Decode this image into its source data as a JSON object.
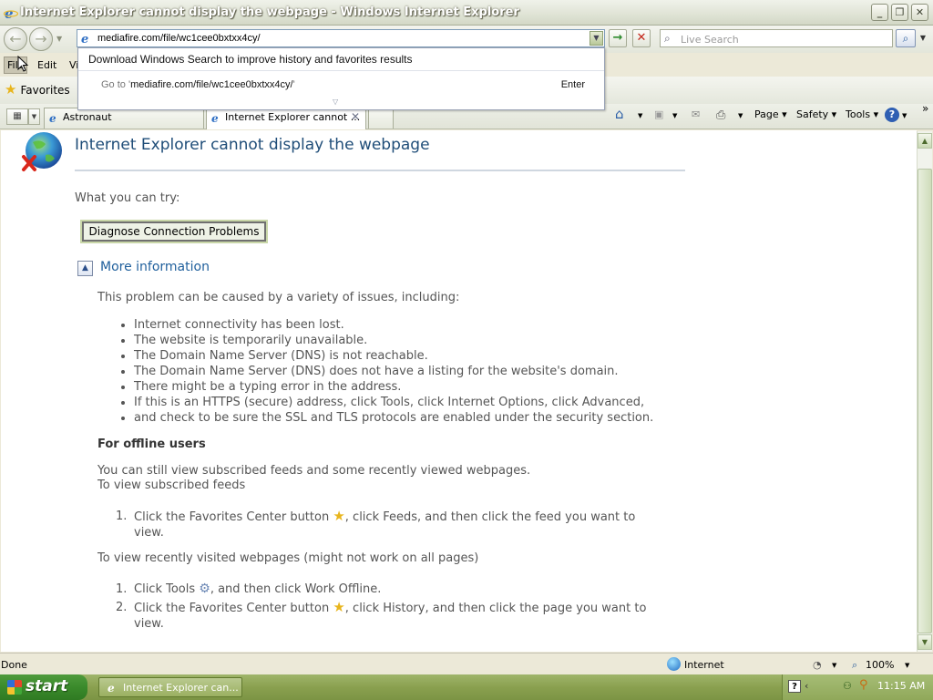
{
  "window": {
    "title": "Internet Explorer cannot display the webpage - Windows Internet Explorer",
    "controls": {
      "minimize": "_",
      "maximize": "❐",
      "close": "✕"
    }
  },
  "nav": {
    "address": "mediafire.com/file/wc1cee0bxtxx4cy/",
    "search_placeholder": "Live Search"
  },
  "autocomplete": {
    "promo": "Download Windows Search to improve history and favorites results",
    "goto_prefix": "Go to '",
    "goto_url": "mediafire.com/file/wc1cee0bxtxx4cy/",
    "goto_suffix": "'",
    "enter_label": "Enter"
  },
  "menu": {
    "file": "File",
    "edit": "Edit",
    "view": "Vi"
  },
  "favorites": {
    "label": "Favorites"
  },
  "tabs": [
    {
      "label": "Astronaut"
    },
    {
      "label": "Internet Explorer cannot ..."
    }
  ],
  "commandbar": {
    "page": "Page",
    "safety": "Safety",
    "tools": "Tools"
  },
  "page": {
    "title": "Internet Explorer cannot display the webpage",
    "what_you_can_try": "What you can try:",
    "diagnose_button": "Diagnose Connection Problems",
    "more_information": "More information",
    "problem_intro": "This problem can be caused by a variety of issues, including:",
    "causes": [
      "Internet connectivity has been lost.",
      "The website is temporarily unavailable.",
      "The Domain Name Server (DNS) is not reachable.",
      "The Domain Name Server (DNS) does not have a listing for the website's domain.",
      "There might be a typing error in the address.",
      "If this is an HTTPS (secure) address, click Tools, click Internet Options, click Advanced,",
      "and check to be sure the SSL and TLS protocols are enabled under the security section."
    ],
    "offline_heading": "For offline users",
    "offline_line1": "You can still view subscribed feeds and some recently viewed webpages.",
    "offline_line2": "To view subscribed feeds",
    "feeds_steps": [
      {
        "n": "1.",
        "a": "Click the Favorites Center button ",
        "b": ", click Feeds, and then click the feed you want to",
        "c": "view."
      }
    ],
    "recent_heading": "To view recently visited webpages (might not work on all pages)",
    "recent_steps": [
      {
        "n": "1.",
        "a": "Click Tools ",
        "b": ", and then click Work Offline."
      },
      {
        "n": "2.",
        "a": "Click the Favorites Center button ",
        "b": ", click History, and then click the page you want to",
        "c": "view."
      }
    ]
  },
  "status": {
    "left": "Done",
    "zone": "Internet",
    "zoom": "100%"
  },
  "taskbar": {
    "start": "start",
    "item": "Internet Explorer can...",
    "clock": "11:15 AM"
  }
}
